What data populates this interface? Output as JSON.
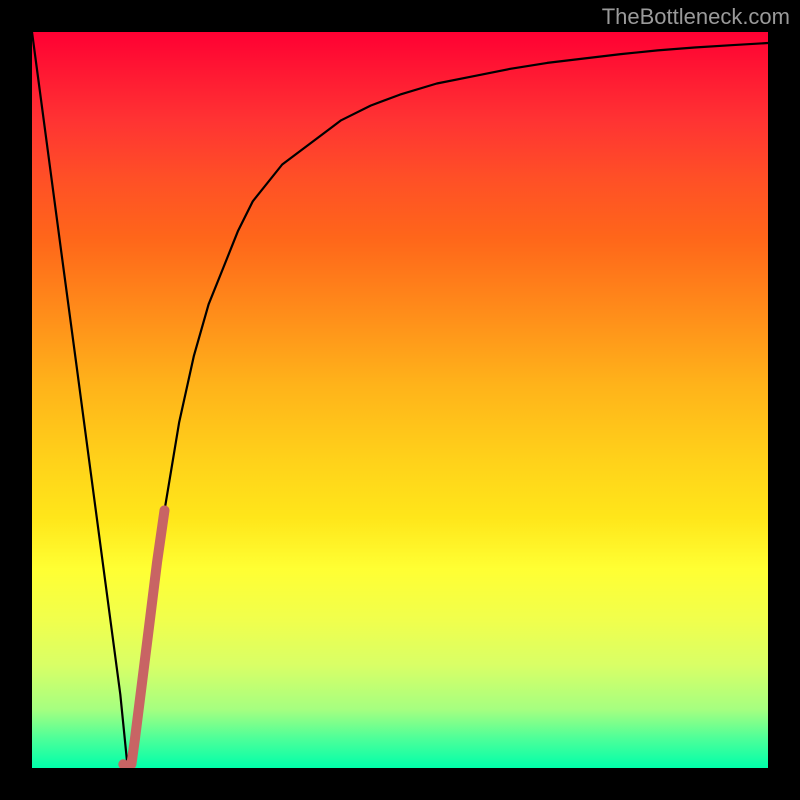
{
  "watermark": {
    "text": "TheBottleneck.com"
  },
  "colors": {
    "page_bg": "#000000",
    "curve": "#000000",
    "accent_segment": "#c86464",
    "gradient_top": "#ff0033",
    "gradient_bottom": "#00ffaa"
  },
  "chart_data": {
    "type": "line",
    "title": "",
    "xlabel": "",
    "ylabel": "",
    "xlim": [
      0,
      100
    ],
    "ylim": [
      0,
      100
    ],
    "grid": false,
    "legend": false,
    "x": [
      0,
      2,
      4,
      6,
      8,
      10,
      12,
      13,
      14,
      16,
      18,
      20,
      22,
      24,
      26,
      28,
      30,
      34,
      38,
      42,
      46,
      50,
      55,
      60,
      65,
      70,
      75,
      80,
      85,
      90,
      95,
      100
    ],
    "series": [
      {
        "name": "bottleneck-curve",
        "values": [
          100,
          85,
          70,
          55,
          40,
          25,
          10,
          0,
          5,
          20,
          35,
          47,
          56,
          63,
          68,
          73,
          77,
          82,
          85,
          88,
          90,
          91.5,
          93,
          94,
          95,
          95.8,
          96.4,
          97,
          97.5,
          97.9,
          98.2,
          98.5
        ]
      }
    ],
    "accent_segment": {
      "note": "thick reddish stroke overlay on the curve near the minimum",
      "x": [
        12.4,
        13,
        13.5,
        14,
        15,
        16,
        17,
        18
      ],
      "values": [
        0.5,
        0.2,
        0.5,
        4,
        12,
        20,
        28,
        35
      ]
    },
    "background_gradient_stops": [
      {
        "pct": 0,
        "color": "#ff0033"
      },
      {
        "pct": 12,
        "color": "#ff3333"
      },
      {
        "pct": 28,
        "color": "#ff661a"
      },
      {
        "pct": 48,
        "color": "#ffb31a"
      },
      {
        "pct": 66,
        "color": "#ffe61a"
      },
      {
        "pct": 80,
        "color": "#f0ff4d"
      },
      {
        "pct": 92,
        "color": "#a6ff80"
      },
      {
        "pct": 100,
        "color": "#00ffaa"
      }
    ]
  }
}
